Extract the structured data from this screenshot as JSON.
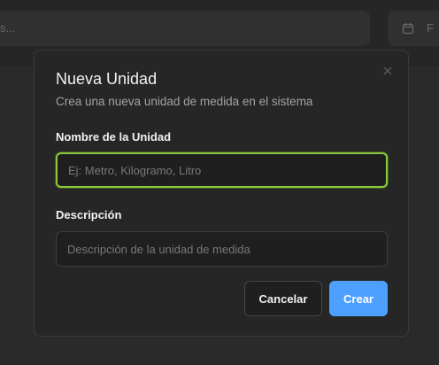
{
  "background": {
    "search_text": "s...",
    "date_text": "F"
  },
  "modal": {
    "title": "Nueva Unidad",
    "subtitle": "Crea una nueva unidad de medida en el sistema",
    "close_icon": "close-icon",
    "fields": {
      "name": {
        "label": "Nombre de la Unidad",
        "placeholder": "Ej: Metro, Kilogramo, Litro",
        "value": ""
      },
      "description": {
        "label": "Descripción",
        "placeholder": "Descripción de la unidad de medida",
        "value": ""
      }
    },
    "buttons": {
      "cancel": "Cancelar",
      "create": "Crear"
    }
  },
  "colors": {
    "focus_ring": "#8cc63f",
    "primary": "#4ea0ff"
  }
}
